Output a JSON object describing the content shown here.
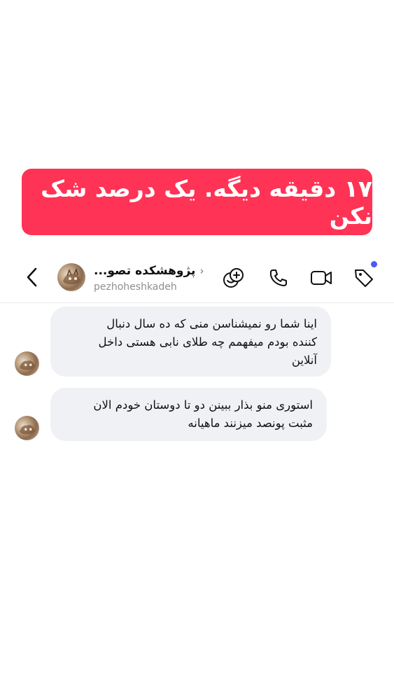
{
  "banner": {
    "text": "۱۷ دقیقه دیگه. یک درصد شک نکن"
  },
  "header": {
    "title": "پژوهشکده تصو...",
    "username": "pezhoheshkadeh",
    "back_icon": "chevron-left-icon",
    "icons": [
      "add-effect-icon",
      "phone-icon",
      "video-icon",
      "tag-icon"
    ],
    "notification_dot_color": "#4a5cf5"
  },
  "messages": [
    {
      "lines": [
        "اینا شما رو نمیشناسن منی که ده سال دنبال",
        "کننده بودم میفهمم چه طلای نابی هستی داخل",
        "آنلاین"
      ]
    },
    {
      "lines": [
        "استوری منو بذار ببینن دو تا دوستان خودم الان",
        "مثبت پونصد میزنند ماهیانه"
      ]
    }
  ],
  "colors": {
    "banner": "#ff3355",
    "bubble": "#f0f1f4"
  }
}
